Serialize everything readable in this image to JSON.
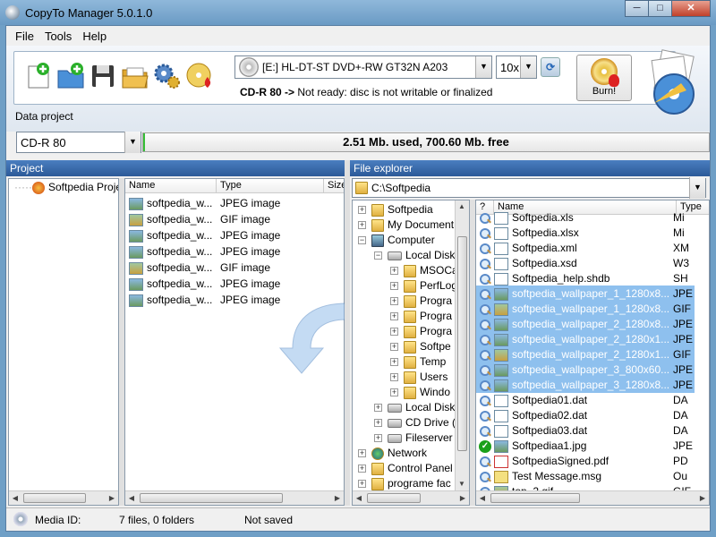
{
  "window": {
    "title": "CopyTo Manager 5.0.1.0",
    "minimize": "─",
    "maximize": "□",
    "close": "✕"
  },
  "menu": [
    "File",
    "Tools",
    "Help"
  ],
  "toolbar": {
    "drive": "[E:] HL-DT-ST DVD+-RW GT32N A203",
    "speed": "10x",
    "status_prefix": "CD-R 80 ->",
    "status_text": "Not ready: disc is not writable or finalized",
    "burn_label": "Burn!"
  },
  "data_project": {
    "label": "Data project",
    "disc_type": "CD-R 80",
    "usage": "2.51 Mb. used, 700.60 Mb. free",
    "usage_fraction": 0.0036
  },
  "project": {
    "header": "Project",
    "tree_root": "Softpedia Proje",
    "columns": [
      "Name",
      "Type",
      "Size"
    ],
    "files": [
      {
        "name": "softpedia_w...",
        "type": "JPEG image",
        "icon": "jpeg-icon"
      },
      {
        "name": "softpedia_w...",
        "type": "GIF image",
        "icon": "gif-icon"
      },
      {
        "name": "softpedia_w...",
        "type": "JPEG image",
        "icon": "jpeg-icon"
      },
      {
        "name": "softpedia_w...",
        "type": "JPEG image",
        "icon": "jpeg-icon"
      },
      {
        "name": "softpedia_w...",
        "type": "GIF image",
        "icon": "gif-icon"
      },
      {
        "name": "softpedia_w...",
        "type": "JPEG image",
        "icon": "jpeg-icon"
      },
      {
        "name": "softpedia_w...",
        "type": "JPEG image",
        "icon": "jpeg-icon"
      }
    ]
  },
  "explorer": {
    "header": "File explorer",
    "path": "C:\\Softpedia",
    "tree": [
      {
        "label": "Softpedia",
        "exp": "+",
        "indent": 0,
        "icon": "folder"
      },
      {
        "label": "My Document",
        "exp": "+",
        "indent": 0,
        "icon": "folder"
      },
      {
        "label": "Computer",
        "exp": "−",
        "indent": 0,
        "icon": "computer"
      },
      {
        "label": "Local Disk",
        "exp": "−",
        "indent": 1,
        "icon": "drive"
      },
      {
        "label": "MSOCa",
        "exp": "+",
        "indent": 2,
        "icon": "folder"
      },
      {
        "label": "PerfLog",
        "exp": "+",
        "indent": 2,
        "icon": "folder"
      },
      {
        "label": "Progra",
        "exp": "+",
        "indent": 2,
        "icon": "folder"
      },
      {
        "label": "Progra",
        "exp": "+",
        "indent": 2,
        "icon": "folder"
      },
      {
        "label": "Progra",
        "exp": "+",
        "indent": 2,
        "icon": "folder"
      },
      {
        "label": "Softpe",
        "exp": "+",
        "indent": 2,
        "icon": "folder"
      },
      {
        "label": "Temp",
        "exp": "+",
        "indent": 2,
        "icon": "folder"
      },
      {
        "label": "Users",
        "exp": "+",
        "indent": 2,
        "icon": "folder"
      },
      {
        "label": "Windo",
        "exp": "+",
        "indent": 2,
        "icon": "folder"
      },
      {
        "label": "Local Disk",
        "exp": "+",
        "indent": 1,
        "icon": "drive"
      },
      {
        "label": "CD Drive (E",
        "exp": "+",
        "indent": 1,
        "icon": "drive"
      },
      {
        "label": "Fileserver (",
        "exp": "+",
        "indent": 1,
        "icon": "drive"
      },
      {
        "label": "Network",
        "exp": "+",
        "indent": 0,
        "icon": "network"
      },
      {
        "label": "Control Panel",
        "exp": "+",
        "indent": 0,
        "icon": "folder"
      },
      {
        "label": "programe fac",
        "exp": "+",
        "indent": 0,
        "icon": "folder"
      }
    ],
    "columns": [
      "?",
      "Name",
      "Type"
    ],
    "files": [
      {
        "name": "Softpedia.xls",
        "type": "Mi",
        "status": "mag",
        "icon": "doc",
        "sel": false
      },
      {
        "name": "Softpedia.xlsx",
        "type": "Mi",
        "status": "mag",
        "icon": "doc",
        "sel": false
      },
      {
        "name": "Softpedia.xml",
        "type": "XM",
        "status": "mag",
        "icon": "doc",
        "sel": false
      },
      {
        "name": "Softpedia.xsd",
        "type": "W3",
        "status": "mag",
        "icon": "doc",
        "sel": false
      },
      {
        "name": "Softpedia_help.shdb",
        "type": "SH",
        "status": "mag",
        "icon": "doc",
        "sel": false
      },
      {
        "name": "softpedia_wallpaper_1_1280x8...",
        "type": "JPE",
        "status": "mag",
        "icon": "jpeg",
        "sel": true
      },
      {
        "name": "softpedia_wallpaper_1_1280x8...",
        "type": "GIF",
        "status": "mag",
        "icon": "gif",
        "sel": true
      },
      {
        "name": "softpedia_wallpaper_2_1280x8...",
        "type": "JPE",
        "status": "mag",
        "icon": "jpeg",
        "sel": true
      },
      {
        "name": "softpedia_wallpaper_2_1280x1...",
        "type": "JPE",
        "status": "mag",
        "icon": "jpeg",
        "sel": true
      },
      {
        "name": "softpedia_wallpaper_2_1280x1...",
        "type": "GIF",
        "status": "mag",
        "icon": "gif",
        "sel": true
      },
      {
        "name": "softpedia_wallpaper_3_800x60...",
        "type": "JPE",
        "status": "mag",
        "icon": "jpeg",
        "sel": true
      },
      {
        "name": "softpedia_wallpaper_3_1280x8...",
        "type": "JPE",
        "status": "mag",
        "icon": "jpeg",
        "sel": true
      },
      {
        "name": "Softpedia01.dat",
        "type": "DA",
        "status": "mag",
        "icon": "doc",
        "sel": false
      },
      {
        "name": "Softpedia02.dat",
        "type": "DA",
        "status": "mag",
        "icon": "doc",
        "sel": false
      },
      {
        "name": "Softpedia03.dat",
        "type": "DA",
        "status": "mag",
        "icon": "doc",
        "sel": false
      },
      {
        "name": "Softpediaa1.jpg",
        "type": "JPE",
        "status": "check",
        "icon": "jpeg",
        "sel": false
      },
      {
        "name": "SoftpediaSigned.pdf",
        "type": "PD",
        "status": "mag",
        "icon": "pdf",
        "sel": false
      },
      {
        "name": "Test Message.msg",
        "type": "Ou",
        "status": "mag",
        "icon": "msg",
        "sel": false
      },
      {
        "name": "top_2.gif",
        "type": "GIF",
        "status": "mag",
        "icon": "gif",
        "sel": false
      }
    ]
  },
  "statusbar": {
    "media_label": "Media ID:",
    "counts": "7 files, 0 folders",
    "saved": "Not saved"
  }
}
